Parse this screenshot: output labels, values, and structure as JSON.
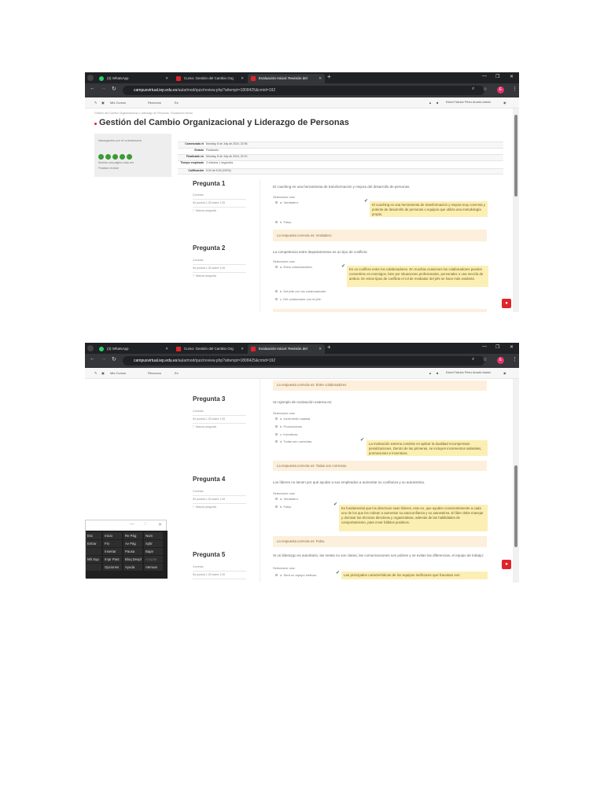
{
  "browser": {
    "tabs": [
      {
        "label": "(3) WhatsApp"
      },
      {
        "label": "Curso: Gestión del Cambio Org"
      },
      {
        "label": "Evaluación Inicial: Revisión del"
      }
    ],
    "url_domain": "campusvirtual.iep.edu.es",
    "url_path": "/aula/mod/quiz/review.php?attempt=1808425&cmid=192",
    "avatar": "E"
  },
  "toolbar": {
    "mis_cursos": "Mis Cursos",
    "recursos": "Recursos",
    "lang": "Es",
    "user": "Edwin Fabricio Pérez Arcadio Asiedo"
  },
  "breadcrumb": "Gestión del Cambio Organizacional y Liderazgo de Personas / Evaluación inicial",
  "title": "Gestión del Cambio Organizacional y Liderazgo de Personas",
  "quiz_nav": {
    "title": "Navegación por el cuestionario",
    "show_one": "Mostrar una página cada vez",
    "finish": "Finalizar revisión"
  },
  "summary": [
    {
      "k": "Comenzado el",
      "v": "Monday, 8 de July de 2024, 22:06"
    },
    {
      "k": "Estado",
      "v": "Finalizado"
    },
    {
      "k": "Finalizado en",
      "v": "Monday, 8 de July de 2024, 22:10"
    },
    {
      "k": "Tiempo empleado",
      "v": "3 minutos 1 segundos"
    },
    {
      "k": "Calificación",
      "v": "5,00 de 5,00 (100%)"
    }
  ],
  "side": {
    "state": "Correcta",
    "score": "Se puntúa 1,00 sobre 1,00",
    "flag": "Marcar pregunta"
  },
  "select_one": "Seleccione una:",
  "questions": [
    {
      "title": "Pregunta 1",
      "text": "El coaching es una herramienta de transformación y mejora del desarrollo de personas.",
      "options": [
        "a.  Verdadero.",
        "b.  Falso."
      ],
      "feedback": "El coaching es una herramienta de transformación y mejora muy concreta y potente de desarrollo de personas o equipos que utiliza una metodología propia.",
      "correct": "La respuesta correcta es: Verdadero"
    },
    {
      "title": "Pregunta 2",
      "text": "La competencia entre departamentos es un tipo de conflicto:",
      "options": [
        "a.  Entre colaboradores.",
        "b.  Del jefe con los colaboradores.",
        "c.  Del colaborador con el jefe."
      ],
      "feedback": "Es un conflicto entre los colaboradores. En muchas ocasiones los colaboradores pueden convertirse en enemigos, bien por situaciones profesionales, personales o una mezcla de ambos. En estos tipos de conflicto el rol de mediador del jefe se hace más evidente.",
      "correct": "La respuesta correcta es: Entre colaboradores"
    },
    {
      "title": "Pregunta 3",
      "text": "Un ejemplo de motivación externa es:",
      "options": [
        "a.  Incremento salarial.",
        "b.  Promociones.",
        "c.  Incentivos.",
        "d.  Todas son correctas."
      ],
      "feedback": "La motivación externa consiste en aplicar la dualidad recompensas-penalizaciones. Dentro de las primeras, se incluyen incrementos salariales, promociones e incentivos.",
      "correct": "La respuesta correcta es: Todas son correctas."
    },
    {
      "title": "Pregunta 4",
      "text": "Los líderes no tienen por qué ayudar a sus empleados a aumentar su confianza y su autoestima.",
      "options": [
        "a.  Verdadero.",
        "b.  Falso."
      ],
      "feedback": "Es fundamental que los directivos sean líderes, esto es, que ayuden conscientemente a cada uno de los que les rodean a aumentar su autoconfianza y su autoestima. El líder debe manejar y dominar las técnicas directivas y organizativas, además de las habilidades de comportamiento, para crear hábitos positivos.",
      "correct": "La respuesta correcta es: Falso."
    },
    {
      "title": "Pregunta 5",
      "text": "Si un liderazgo es autoritario, las metas no son claras, las comunicaciones son pobres y se evitan las diferencias, el equipo de trabajo:",
      "options": [
        "a.  Será un equipo ineficaz."
      ],
      "feedback": "Las principales características de los equipos ineficaces que fracasan son"
    }
  ],
  "keyboard": {
    "keys": [
      "Esc",
      "Inicio",
      "Re Pág",
      "Num",
      "Entrar",
      "Fin",
      "Av Pág",
      "Sybr",
      "",
      "Insertar",
      "Pausa",
      "Bajar",
      "Mb Sup",
      "Impr Pant",
      "Bloq Despl",
      "Acoplar",
      "",
      "Opciones",
      "Ayuda",
      "Atenuar"
    ]
  },
  "colors": {
    "accent": "#e0242b",
    "correct": "#357a32",
    "feedback_bg": "#fcefb4"
  }
}
